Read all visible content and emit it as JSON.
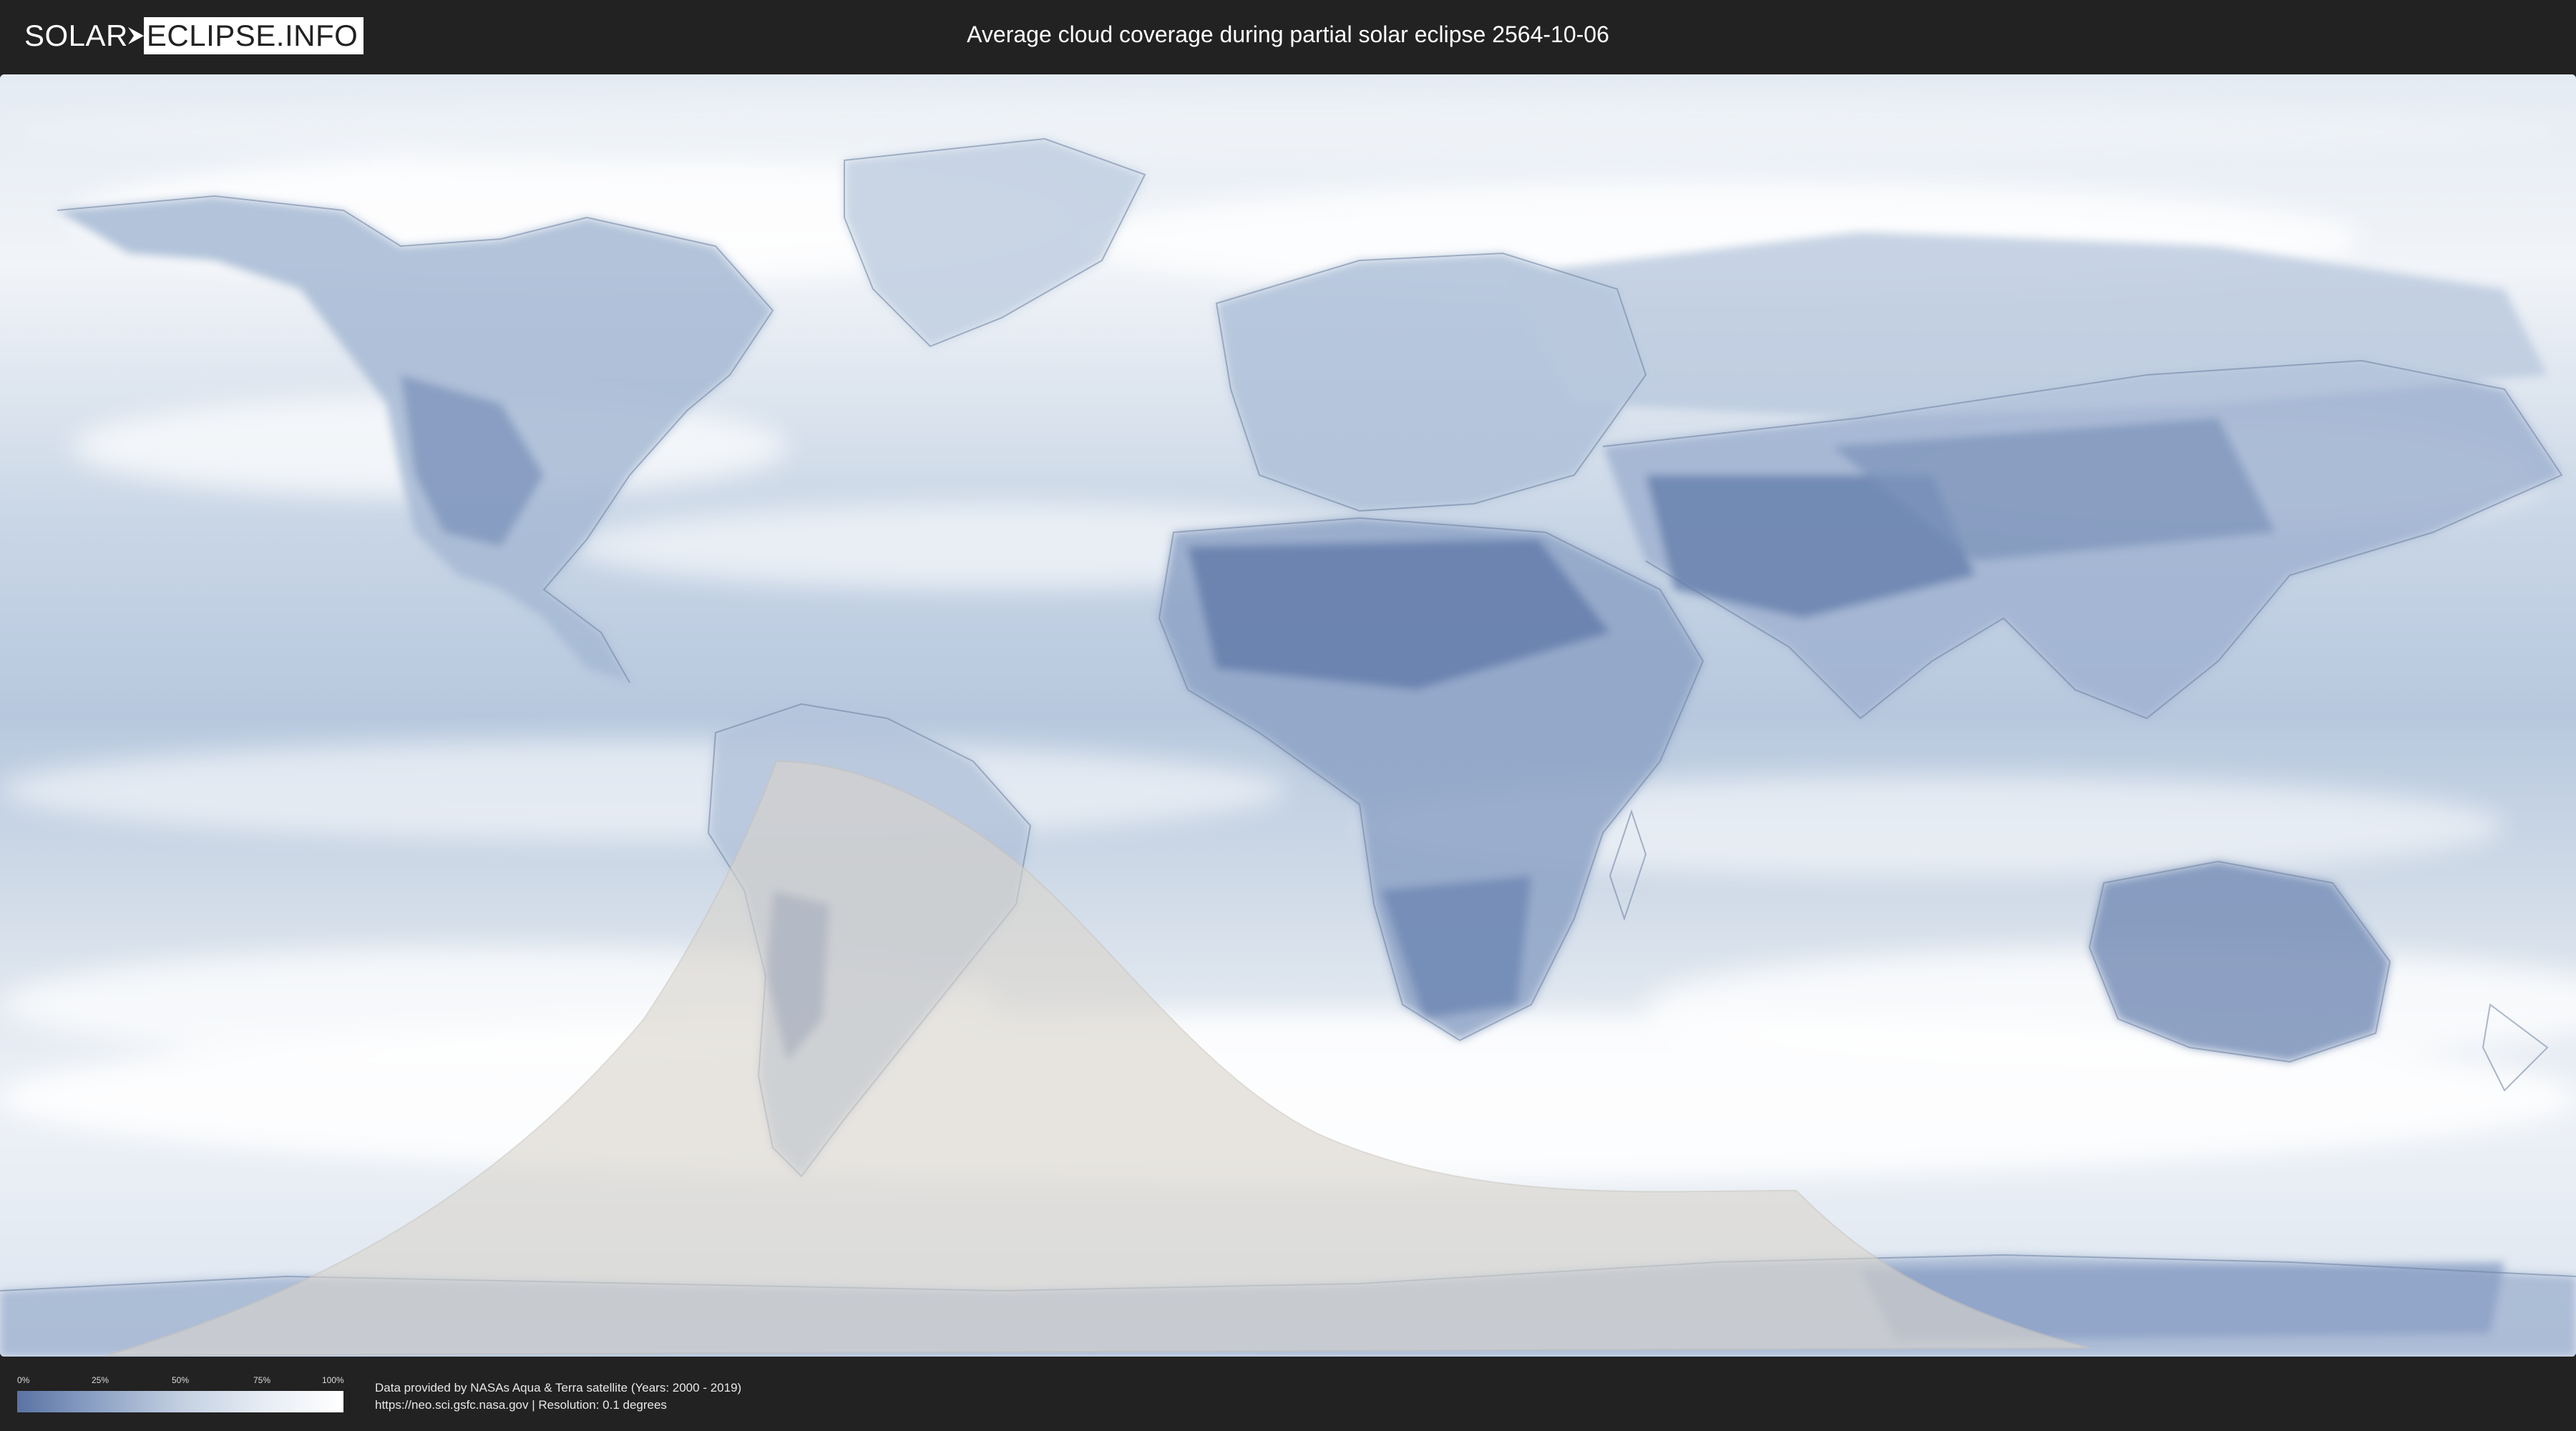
{
  "logo": {
    "part1": "SOLAR",
    "part2": "ECLIPSE.INFO"
  },
  "title": "Average cloud coverage during partial solar eclipse 2564-10-06",
  "legend": {
    "ticks": [
      "0%",
      "25%",
      "50%",
      "75%",
      "100%"
    ],
    "color_low": "#5b73a4",
    "color_high": "#ffffff"
  },
  "credits": {
    "line1": "Data provided by NASAs Aqua & Terra satellite (Years: 2000 - 2019)",
    "line2": "https://neo.sci.gsfc.nasa.gov | Resolution: 0.1 degrees"
  },
  "colors": {
    "background": "#222222",
    "clear_sky": "#5b73a4",
    "cloud": "#ffffff",
    "eclipse_overlay": "#d9d4cc"
  }
}
